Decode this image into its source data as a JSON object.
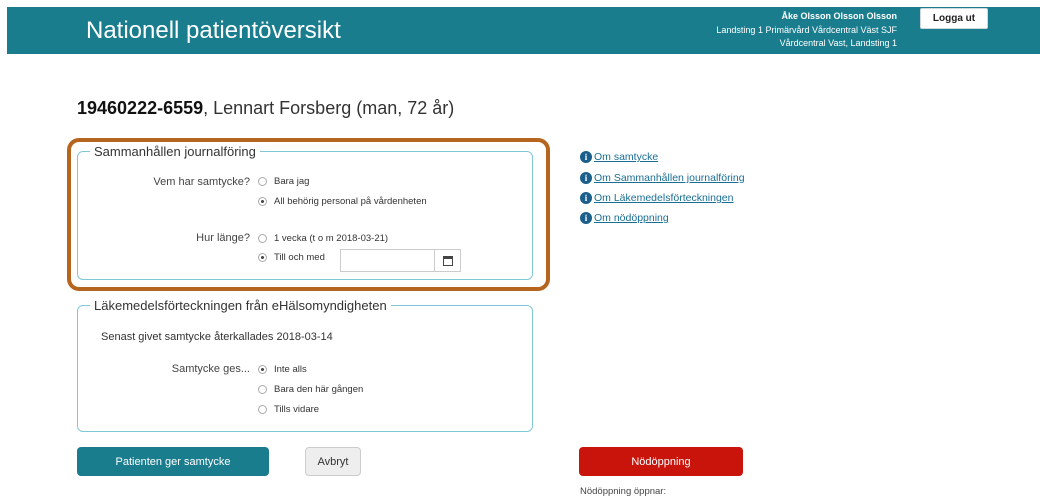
{
  "header": {
    "title": "Nationell patientöversikt",
    "user_name": "Åke Olsson Olsson Olsson",
    "user_org_1": "Landsting 1 Primärvård Vårdcentral Väst SJF",
    "user_org_2": "Vårdcentral Vast, Landsting 1",
    "logout_label": "Logga ut"
  },
  "patient": {
    "personnummer": "19460222-6559",
    "details": ", Lennart Forsberg (man, 72 år)"
  },
  "consent_section": {
    "legend": "Sammanhållen journalföring",
    "who_label": "Vem har samtycke?",
    "who_options": [
      {
        "label": "Bara jag",
        "selected": false
      },
      {
        "label": "All behörig personal på vårdenheten",
        "selected": true
      }
    ],
    "duration_label": "Hur länge?",
    "duration_options": [
      {
        "label": "1 vecka (t o m 2018-03-21)",
        "selected": false
      },
      {
        "label": "Till och med",
        "selected": true
      }
    ],
    "date_value": ""
  },
  "medication_section": {
    "legend": "Läkemedelsförteckningen från eHälsomyndigheten",
    "status_text": "Senast givet samtycke återkallades 2018-03-14",
    "consent_label": "Samtycke ges...",
    "options": [
      {
        "label": "Inte alls",
        "selected": true
      },
      {
        "label": "Bara den här gången",
        "selected": false
      },
      {
        "label": "Tills vidare",
        "selected": false
      }
    ]
  },
  "info_links": [
    {
      "label": "Om samtycke"
    },
    {
      "label": "Om Sammanhållen journalföring"
    },
    {
      "label": "Om Läkemedelsförteckningen"
    },
    {
      "label": "Om nödöppning"
    }
  ],
  "actions": {
    "consent_button": "Patienten ger samtycke",
    "cancel_button": "Avbryt",
    "emergency_button": "Nödöppning",
    "emergency_note": "Nödöppning öppnar:"
  },
  "colors": {
    "header_bg": "#1a7d8e",
    "highlight_border": "#b5651d",
    "emergency": "#c8140a",
    "link": "#1a6e94"
  }
}
